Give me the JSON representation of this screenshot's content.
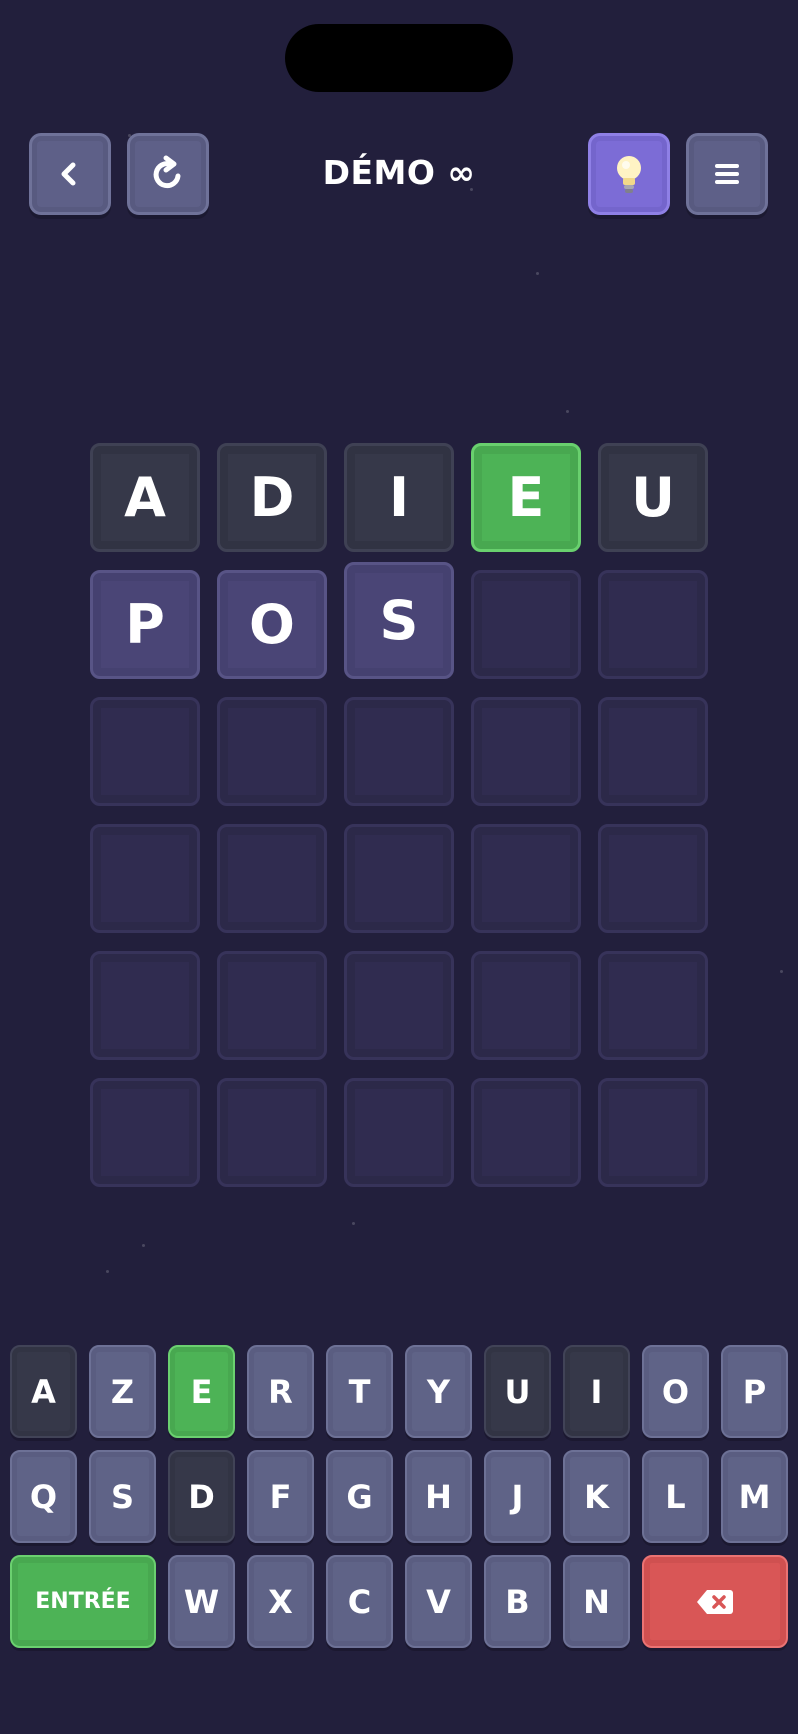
{
  "header": {
    "title": "DÉMO ∞",
    "back_icon": "chevron-left-icon",
    "restart_icon": "refresh-icon",
    "hint_icon": "lightbulb-icon",
    "menu_icon": "hamburger-menu-icon"
  },
  "colors": {
    "background": "#221f3c",
    "correct": "#4db356",
    "absent": "#363849",
    "empty": "#302c50",
    "typed": "#4a4576",
    "key": "#5f6387",
    "hint": "#7c6cd6",
    "delete": "#d95656"
  },
  "board": {
    "rows": [
      [
        {
          "letter": "A",
          "state": "absent"
        },
        {
          "letter": "D",
          "state": "absent"
        },
        {
          "letter": "I",
          "state": "absent"
        },
        {
          "letter": "E",
          "state": "correct"
        },
        {
          "letter": "U",
          "state": "absent"
        }
      ],
      [
        {
          "letter": "P",
          "state": "typed"
        },
        {
          "letter": "O",
          "state": "typed"
        },
        {
          "letter": "S",
          "state": "active"
        },
        {
          "letter": "",
          "state": "empty"
        },
        {
          "letter": "",
          "state": "empty"
        }
      ],
      [
        {
          "letter": "",
          "state": "empty"
        },
        {
          "letter": "",
          "state": "empty"
        },
        {
          "letter": "",
          "state": "empty"
        },
        {
          "letter": "",
          "state": "empty"
        },
        {
          "letter": "",
          "state": "empty"
        }
      ],
      [
        {
          "letter": "",
          "state": "empty"
        },
        {
          "letter": "",
          "state": "empty"
        },
        {
          "letter": "",
          "state": "empty"
        },
        {
          "letter": "",
          "state": "empty"
        },
        {
          "letter": "",
          "state": "empty"
        }
      ],
      [
        {
          "letter": "",
          "state": "empty"
        },
        {
          "letter": "",
          "state": "empty"
        },
        {
          "letter": "",
          "state": "empty"
        },
        {
          "letter": "",
          "state": "empty"
        },
        {
          "letter": "",
          "state": "empty"
        }
      ],
      [
        {
          "letter": "",
          "state": "empty"
        },
        {
          "letter": "",
          "state": "empty"
        },
        {
          "letter": "",
          "state": "empty"
        },
        {
          "letter": "",
          "state": "empty"
        },
        {
          "letter": "",
          "state": "empty"
        }
      ]
    ]
  },
  "keyboard": {
    "rows": [
      [
        {
          "label": "A",
          "state": "absent"
        },
        {
          "label": "Z",
          "state": "unused"
        },
        {
          "label": "E",
          "state": "correct"
        },
        {
          "label": "R",
          "state": "unused"
        },
        {
          "label": "T",
          "state": "unused"
        },
        {
          "label": "Y",
          "state": "unused"
        },
        {
          "label": "U",
          "state": "absent"
        },
        {
          "label": "I",
          "state": "absent"
        },
        {
          "label": "O",
          "state": "unused"
        },
        {
          "label": "P",
          "state": "unused"
        }
      ],
      [
        {
          "label": "Q",
          "state": "unused"
        },
        {
          "label": "S",
          "state": "unused"
        },
        {
          "label": "D",
          "state": "absent"
        },
        {
          "label": "F",
          "state": "unused"
        },
        {
          "label": "G",
          "state": "unused"
        },
        {
          "label": "H",
          "state": "unused"
        },
        {
          "label": "J",
          "state": "unused"
        },
        {
          "label": "K",
          "state": "unused"
        },
        {
          "label": "L",
          "state": "unused"
        },
        {
          "label": "M",
          "state": "unused"
        }
      ],
      [
        {
          "label": "ENTRÉE",
          "state": "enter"
        },
        {
          "label": "W",
          "state": "unused"
        },
        {
          "label": "X",
          "state": "unused"
        },
        {
          "label": "C",
          "state": "unused"
        },
        {
          "label": "V",
          "state": "unused"
        },
        {
          "label": "B",
          "state": "unused"
        },
        {
          "label": "N",
          "state": "unused"
        },
        {
          "label": "",
          "state": "del",
          "icon": "backspace-icon"
        }
      ]
    ]
  }
}
